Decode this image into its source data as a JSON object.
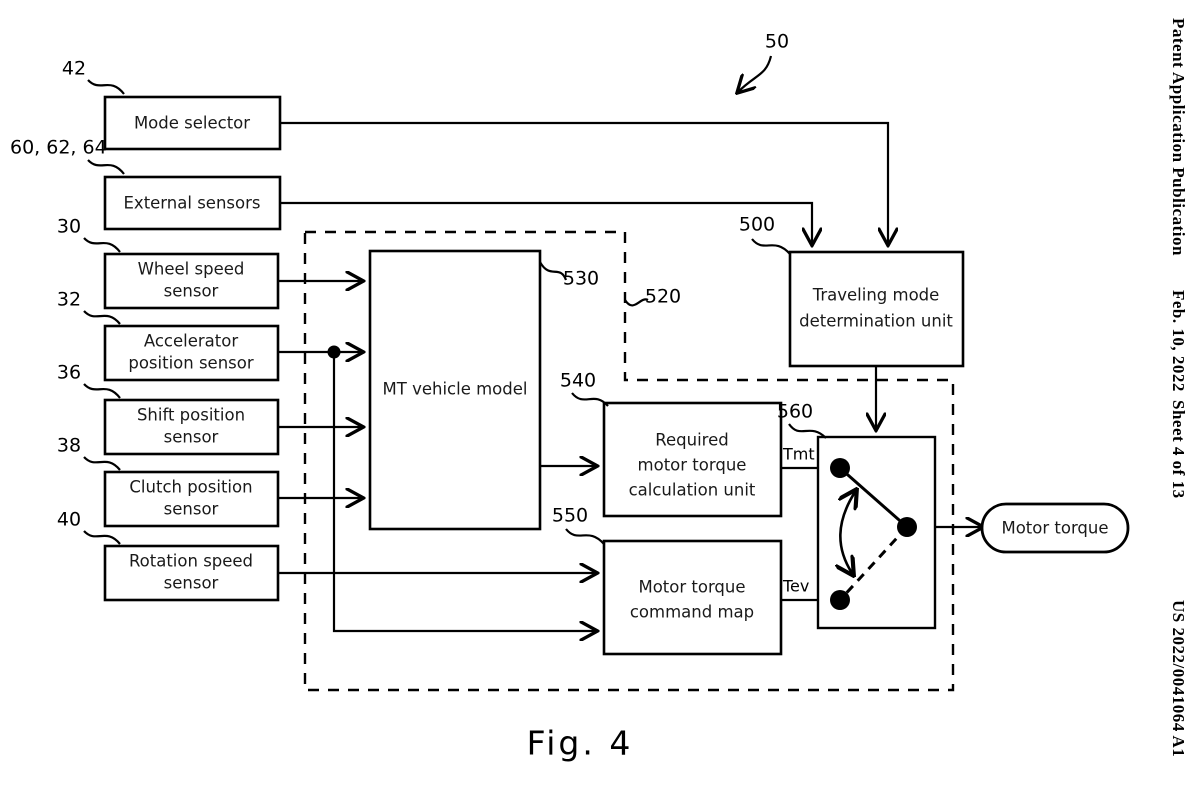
{
  "page": {
    "figure_caption": "Fig. 4",
    "margin": {
      "publication": "Patent Application Publication",
      "date": "Feb. 10, 2022",
      "sheet": "Sheet 4 of 13",
      "pub_number": "US 2022/0041064 A1"
    }
  },
  "diagram": {
    "system_ref": "50",
    "blocks": {
      "mode_selector": {
        "label": "Mode selector",
        "ref": "42"
      },
      "external_sensors": {
        "label": "External sensors",
        "ref": "60, 62, 64"
      },
      "wheel_speed_sensor": {
        "label_line1": "Wheel speed",
        "label_line2": "sensor",
        "ref": "30"
      },
      "accelerator_position_sensor": {
        "label_line1": "Accelerator",
        "label_line2": "position sensor",
        "ref": "32"
      },
      "shift_position_sensor": {
        "label_line1": "Shift position",
        "label_line2": "sensor",
        "ref": "36"
      },
      "clutch_position_sensor": {
        "label_line1": "Clutch position",
        "label_line2": "sensor",
        "ref": "38"
      },
      "rotation_speed_sensor": {
        "label_line1": "Rotation speed",
        "label_line2": "sensor",
        "ref": "40"
      },
      "mt_vehicle_model": {
        "label": "MT vehicle model",
        "ref": "530"
      },
      "traveling_mode_determination_unit": {
        "label_line1": "Traveling mode",
        "label_line2": "determination unit",
        "ref": "500"
      },
      "required_motor_torque_calculation_unit": {
        "label_line1": "Required",
        "label_line2": "motor torque",
        "label_line3": "calculation unit",
        "ref": "540"
      },
      "motor_torque_command_map": {
        "label_line1": "Motor torque",
        "label_line2": "command map",
        "ref": "550"
      },
      "torque_selector_switch": {
        "ref": "560"
      },
      "motor_torque_output": {
        "label": "Motor torque"
      }
    },
    "regions": {
      "simulation_region": {
        "ref": "520"
      }
    },
    "signals": {
      "tmt": "Tmt",
      "tev": "Tev"
    }
  }
}
